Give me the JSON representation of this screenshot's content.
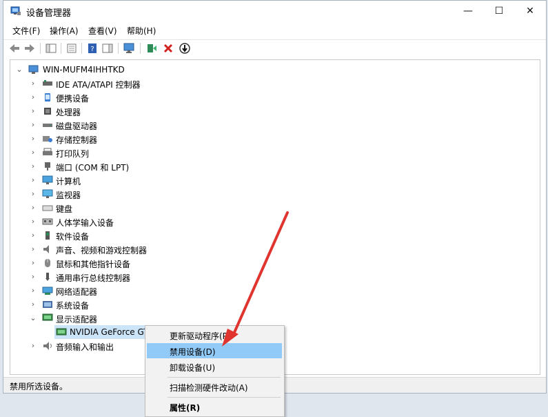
{
  "window": {
    "title": "设备管理器",
    "controls": {
      "minimize": "—",
      "maximize": "☐",
      "close": "✕"
    }
  },
  "menubar": [
    "文件(F)",
    "操作(A)",
    "查看(V)",
    "帮助(H)"
  ],
  "tree": {
    "root": "WIN-MUFM4IHHTKD",
    "items": [
      {
        "label": "IDE ATA/ATAPI 控制器",
        "icon": "ide-controller-icon"
      },
      {
        "label": "便携设备",
        "icon": "portable-device-icon"
      },
      {
        "label": "处理器",
        "icon": "processor-icon"
      },
      {
        "label": "磁盘驱动器",
        "icon": "disk-drive-icon"
      },
      {
        "label": "存储控制器",
        "icon": "storage-controller-icon"
      },
      {
        "label": "打印队列",
        "icon": "printer-icon"
      },
      {
        "label": "端口 (COM 和 LPT)",
        "icon": "port-icon"
      },
      {
        "label": "计算机",
        "icon": "computer-icon"
      },
      {
        "label": "监视器",
        "icon": "monitor-icon"
      },
      {
        "label": "键盘",
        "icon": "keyboard-icon"
      },
      {
        "label": "人体学输入设备",
        "icon": "hid-icon"
      },
      {
        "label": "软件设备",
        "icon": "software-device-icon"
      },
      {
        "label": "声音、视频和游戏控制器",
        "icon": "sound-icon"
      },
      {
        "label": "鼠标和其他指针设备",
        "icon": "mouse-icon"
      },
      {
        "label": "通用串行总线控制器",
        "icon": "usb-icon"
      },
      {
        "label": "网络适配器",
        "icon": "network-adapter-icon"
      },
      {
        "label": "系统设备",
        "icon": "system-device-icon"
      },
      {
        "label": "显示适配器",
        "icon": "display-adapter-icon"
      }
    ],
    "expanded_child": "NVIDIA GeForce GT",
    "last_item": "音频输入和输出"
  },
  "context_menu": {
    "items": [
      "更新驱动程序(P)",
      "禁用设备(D)",
      "卸载设备(U)",
      "扫描检测硬件改动(A)",
      "属性(R)"
    ],
    "highlighted": "禁用设备(D)"
  },
  "status": "禁用所选设备。",
  "colors": {
    "highlight": "#91c9f7",
    "arrow": "#e0342f",
    "selection": "#cce4f7"
  }
}
